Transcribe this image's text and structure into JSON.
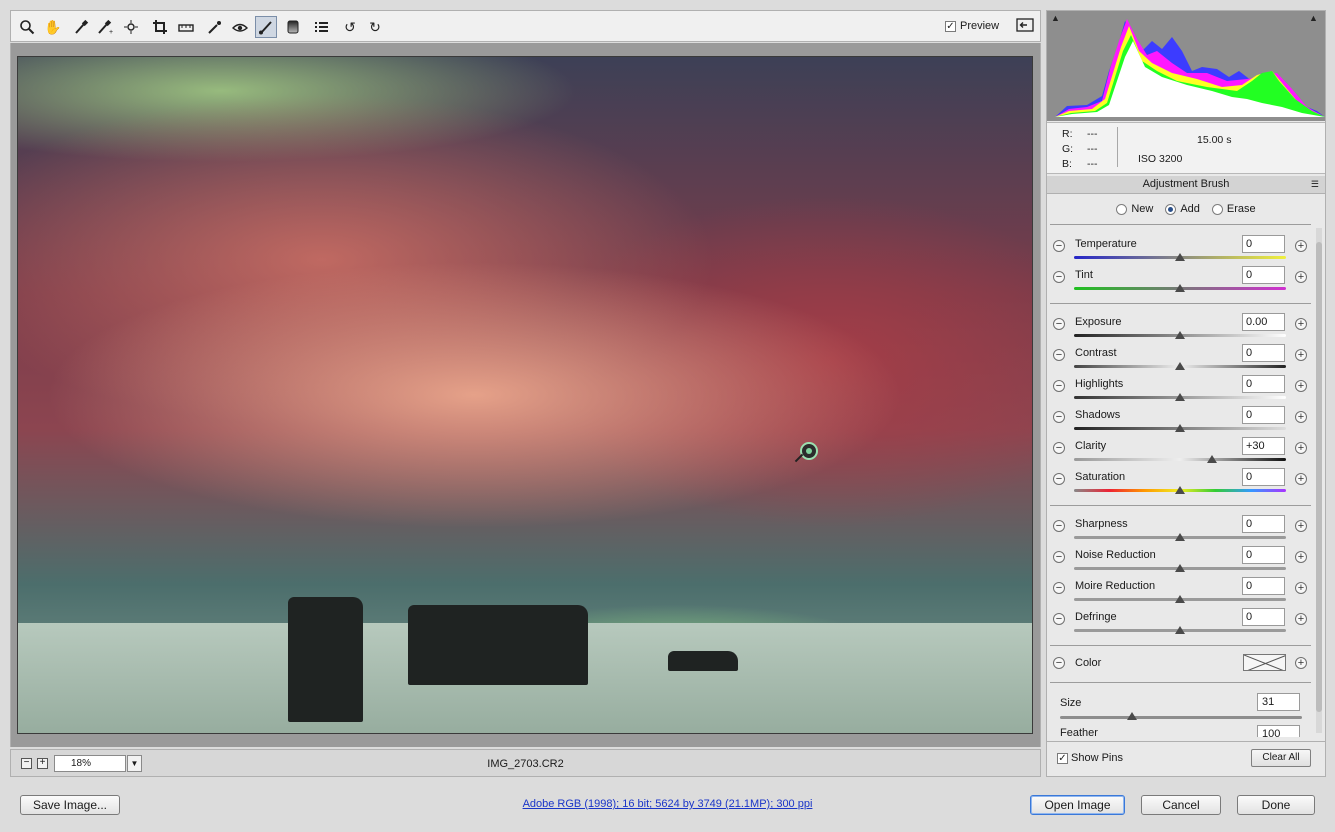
{
  "toolbar": {
    "tools": [
      "zoom-tool-icon",
      "hand-tool-icon",
      "white-balance-icon",
      "color-sampler-icon",
      "targeted-adjustment-icon",
      "crop-icon",
      "straighten-icon",
      "spot-removal-icon",
      "red-eye-icon",
      "adjustment-brush-icon",
      "graduated-filter-icon",
      "preferences-icon",
      "rotate-ccw-icon",
      "rotate-cw-icon"
    ],
    "preview_label": "Preview",
    "preview_checked": "✓"
  },
  "statusbar": {
    "zoom_out": "−",
    "zoom_in": "+",
    "zoom_value": "18%",
    "zoom_dropdown": "▼",
    "filename": "IMG_2703.CR2"
  },
  "readout": {
    "r_label": "R:",
    "r_value": "---",
    "g_label": "G:",
    "g_value": "---",
    "b_label": "B:",
    "b_value": "---",
    "shutter": "15.00 s",
    "iso": "ISO 3200"
  },
  "panel": {
    "title": "Adjustment Brush",
    "modes": [
      "New",
      "Add",
      "Erase"
    ],
    "selected_mode": "Add"
  },
  "sliders": {
    "temperature": {
      "label": "Temperature",
      "value": "0"
    },
    "tint": {
      "label": "Tint",
      "value": "0"
    },
    "exposure": {
      "label": "Exposure",
      "value": "0.00"
    },
    "contrast": {
      "label": "Contrast",
      "value": "0"
    },
    "highlights": {
      "label": "Highlights",
      "value": "0"
    },
    "shadows": {
      "label": "Shadows",
      "value": "0"
    },
    "clarity": {
      "label": "Clarity",
      "value": "+30"
    },
    "saturation": {
      "label": "Saturation",
      "value": "0"
    },
    "sharpness": {
      "label": "Sharpness",
      "value": "0"
    },
    "noise_reduction": {
      "label": "Noise Reduction",
      "value": "0"
    },
    "moire_reduction": {
      "label": "Moire Reduction",
      "value": "0"
    },
    "defringe": {
      "label": "Defringe",
      "value": "0"
    }
  },
  "color": {
    "label": "Color"
  },
  "brush": {
    "size_label": "Size",
    "size_value": "31",
    "feather_label": "Feather",
    "feather_value": "100"
  },
  "footer_panel": {
    "show_pins_label": "Show Pins",
    "show_pins_checked": "✓",
    "clear_all": "Clear All"
  },
  "bottom": {
    "save_image": "Save Image...",
    "workflow": "Adobe RGB (1998); 16 bit; 5624 by 3749 (21.1MP); 300 ppi",
    "open_image": "Open Image",
    "cancel": "Cancel",
    "done": "Done"
  },
  "plus": "+",
  "minus": "−"
}
